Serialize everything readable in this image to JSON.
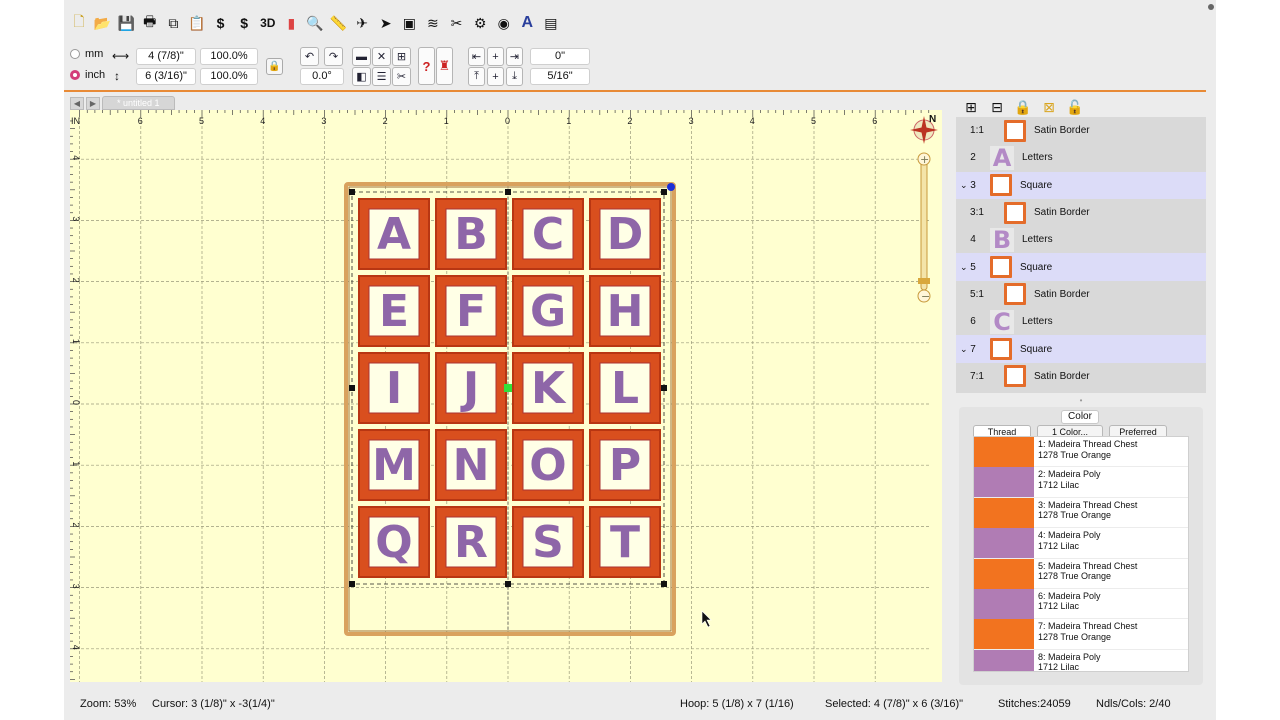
{
  "toolbar": {
    "icons": [
      "new-file-icon",
      "open-folder-icon",
      "save-icon",
      "print-icon",
      "copy-icon",
      "paste-icon",
      "dollar-icon",
      "dollar-alt-icon",
      "3d-icon",
      "bar-chart-icon",
      "magnify-icon",
      "ruler-icon",
      "airplane-icon",
      "pointer-icon",
      "hoop-icon",
      "stitch-icon",
      "sewing-icon",
      "grid-icon",
      "color-icon",
      "text-icon",
      "text-alt-icon"
    ],
    "label_3d": "3D",
    "label_text": "A"
  },
  "units": {
    "mm_label": "mm",
    "inch_label": "inch",
    "selected": "inch"
  },
  "dims": {
    "width": "4 (7/8)\"",
    "width_pct": "100.0%",
    "height": "6 (3/16)\"",
    "height_pct": "100.0%",
    "rotation": "0.0°",
    "offset_x": "0\"",
    "offset_y": "5/16\""
  },
  "tabs": {
    "document": "* untitled 1"
  },
  "canvas": {
    "ruler_top_labels": [
      "6",
      "5",
      "4",
      "3",
      "2",
      "1",
      "0",
      "1",
      "2",
      "3",
      "4",
      "5",
      "6"
    ],
    "ruler_left_labels": [
      "4",
      "3",
      "2",
      "1",
      "0",
      "1",
      "2",
      "3",
      "4"
    ],
    "ruler_unit": "IN",
    "compass_label": "N",
    "letters": [
      "A",
      "B",
      "C",
      "D",
      "E",
      "F",
      "G",
      "H",
      "I",
      "J",
      "K",
      "L",
      "M",
      "N",
      "O",
      "P",
      "Q",
      "R",
      "S",
      "T"
    ],
    "colors": {
      "satin": "#d94f1e",
      "satin_dark": "#b83612",
      "letter": "#8e66a8",
      "canvas_bg": "#ffffd0",
      "grid": "#9a9a7a"
    }
  },
  "status": {
    "zoom": "Zoom: 53%",
    "cursor": "Cursor: 3 (1/8)\" x -3(1/4)\"",
    "hoop": "Hoop: 5 (1/8) x 7 (1/16)",
    "selected": "Selected: 4 (7/8)\" x 6 (3/16)\"",
    "stitches": "Stitches:24059",
    "ndls": "Ndls/Cols: 2/40"
  },
  "object_panel": {
    "icons": [
      "group-icon",
      "ungroup-icon",
      "lock-icon",
      "lock-x-icon",
      "unlock-icon"
    ],
    "rows": [
      {
        "idx": "1:1",
        "name": "Satin Border",
        "thumb": "square",
        "indent": true,
        "expand": ""
      },
      {
        "idx": "2",
        "name": "Letters",
        "thumb": "letter",
        "letter": "A",
        "indent": false,
        "expand": ""
      },
      {
        "idx": "3",
        "name": "Square",
        "thumb": "square",
        "indent": false,
        "expand": "⌄",
        "selected": true
      },
      {
        "idx": "3:1",
        "name": "Satin Border",
        "thumb": "square",
        "indent": true,
        "expand": ""
      },
      {
        "idx": "4",
        "name": "Letters",
        "thumb": "letter",
        "letter": "B",
        "indent": false,
        "expand": ""
      },
      {
        "idx": "5",
        "name": "Square",
        "thumb": "square",
        "indent": false,
        "expand": "⌄",
        "selected": true
      },
      {
        "idx": "5:1",
        "name": "Satin Border",
        "thumb": "square",
        "indent": true,
        "expand": ""
      },
      {
        "idx": "6",
        "name": "Letters",
        "thumb": "letter",
        "letter": "C",
        "indent": false,
        "expand": ""
      },
      {
        "idx": "7",
        "name": "Square",
        "thumb": "square",
        "indent": false,
        "expand": "⌄",
        "selected": true
      },
      {
        "idx": "7:1",
        "name": "Satin Border",
        "thumb": "square",
        "indent": true,
        "expand": ""
      }
    ]
  },
  "color_panel": {
    "title": "Color",
    "tabs": [
      "Thread",
      "1 Color...",
      "Preferred"
    ],
    "threads": [
      {
        "line1": "1: Madeira Thread Chest",
        "line2": "1278 True Orange",
        "color": "#f2731f"
      },
      {
        "line1": "2: Madeira Poly",
        "line2": "1712 Lilac",
        "color": "#b07cb4"
      },
      {
        "line1": "3: Madeira Thread Chest",
        "line2": "1278 True Orange",
        "color": "#f2731f"
      },
      {
        "line1": "4: Madeira Poly",
        "line2": "1712 Lilac",
        "color": "#b07cb4"
      },
      {
        "line1": "5: Madeira Thread Chest",
        "line2": "1278 True Orange",
        "color": "#f2731f"
      },
      {
        "line1": "6: Madeira Poly",
        "line2": "1712 Lilac",
        "color": "#b07cb4"
      },
      {
        "line1": "7: Madeira Thread Chest",
        "line2": "1278 True Orange",
        "color": "#f2731f"
      },
      {
        "line1": "8: Madeira Poly",
        "line2": "1712 Lilac",
        "color": "#b07cb4"
      }
    ]
  }
}
